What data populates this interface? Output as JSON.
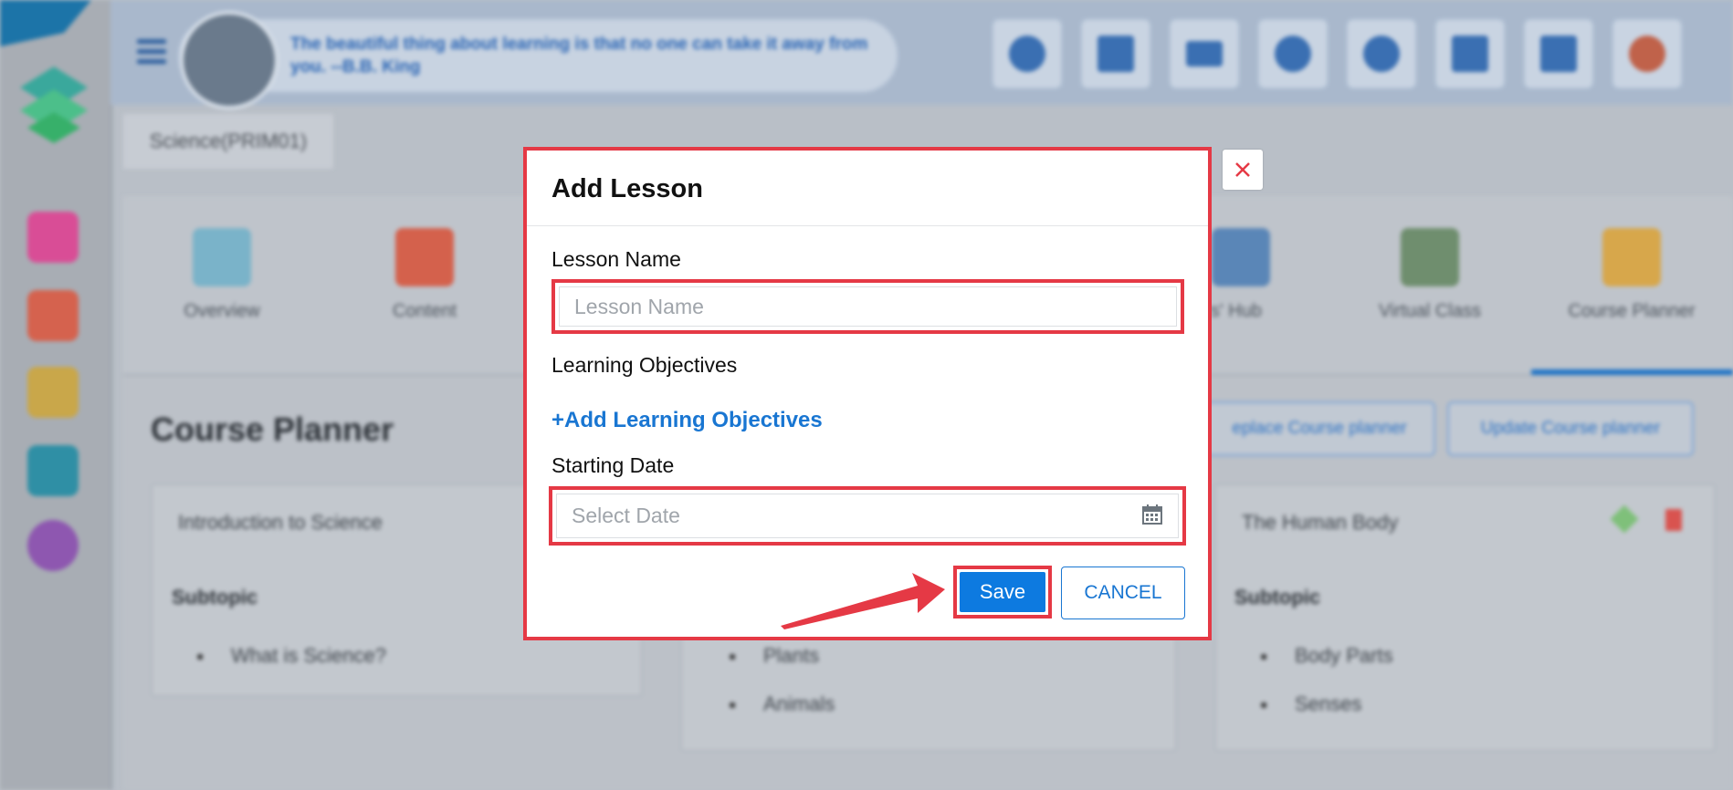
{
  "header": {
    "quote": "The beautiful thing about learning is that no one can take it away from you. --B.B. King"
  },
  "course_tag": "Science(PRIM01)",
  "tabs": [
    {
      "label": "Overview"
    },
    {
      "label": "Content"
    },
    {
      "label": "ners' Hub"
    },
    {
      "label": "Virtual Class"
    },
    {
      "label": "Course Planner"
    }
  ],
  "page_title": "Course Planner",
  "buttons": {
    "replace": "eplace Course planner",
    "update": "Update Course planner"
  },
  "cards": [
    {
      "title": "Introduction to Science",
      "subtopic_label": "Subtopic",
      "items": [
        "What is Science?"
      ]
    },
    {
      "title": "",
      "subtopic_label": "",
      "items": [
        "Plants",
        "Animals"
      ]
    },
    {
      "title": "The Human Body",
      "subtopic_label": "Subtopic",
      "items": [
        "Body Parts",
        "Senses"
      ]
    }
  ],
  "modal": {
    "title": "Add Lesson",
    "lesson_name_label": "Lesson Name",
    "lesson_name_placeholder": "Lesson Name",
    "objectives_label": "Learning Objectives",
    "add_objectives_link": "+Add Learning Objectives",
    "start_date_label": "Starting Date",
    "start_date_placeholder": "Select Date",
    "save_label": "Save",
    "cancel_label": "CANCEL"
  },
  "colors": {
    "highlight": "#e53945",
    "primary": "#0d7ae0",
    "link": "#1976d2"
  },
  "icons": [
    "help-icon",
    "megaphone-icon",
    "mail-icon",
    "bell-icon",
    "smiley-icon",
    "brush-icon",
    "translate-icon",
    "profile-icon",
    "close-icon",
    "calendar-icon",
    "menu-icon"
  ]
}
